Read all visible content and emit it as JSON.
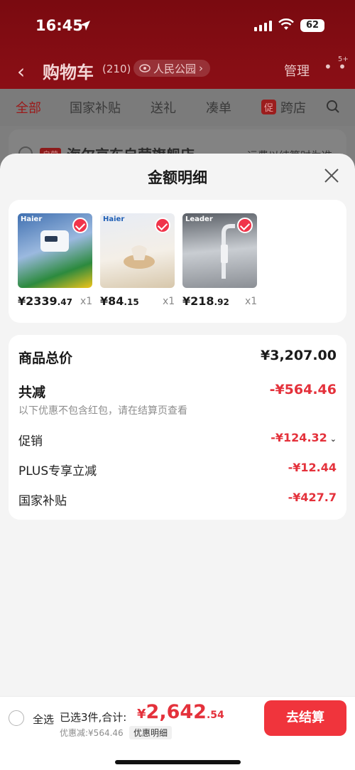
{
  "status_bar": {
    "time": "16:45",
    "battery": "62"
  },
  "header": {
    "title": "购物车",
    "count": "(210)",
    "location": "人民公园",
    "manage": "管理",
    "more_badge": "5+"
  },
  "tabs": [
    {
      "label": "全部"
    },
    {
      "label": "国家补贴"
    },
    {
      "label": "送礼"
    },
    {
      "label": "凑单"
    },
    {
      "label": "跨店",
      "tag": "促"
    }
  ],
  "shop": {
    "tag": "自营",
    "name": "海尔京东自营旗舰店",
    "note": "运费以结算时为准"
  },
  "sheet": {
    "title": "金额明细",
    "products": [
      {
        "brand": "Haier",
        "price_int": "¥2339",
        "price_dec": ".47",
        "qty": "x1"
      },
      {
        "brand": "Haier",
        "price_int": "¥84",
        "price_dec": ".15",
        "qty": "x1"
      },
      {
        "brand": "Leader",
        "price_int": "¥218",
        "price_dec": ".92",
        "qty": "x1"
      }
    ],
    "summary": {
      "total_label": "商品总价",
      "total_value": "¥3,207.00",
      "off_label": "共减",
      "off_value": "-¥564.46",
      "off_note": "以下优惠不包含红包，请在结算页查看",
      "promo_label": "促销",
      "promo_value": "-¥124.32",
      "plus_label": "PLUS专享立减",
      "plus_value": "-¥12.44",
      "subsidy_label": "国家补贴",
      "subsidy_value": "-¥427.7"
    }
  },
  "bottom": {
    "select_all": "全选",
    "selected_text": "已选3件,合计:",
    "total_yen": "¥",
    "total_int": "2,642",
    "total_dec": ".54",
    "discount_line": "优惠减:¥564.46",
    "detail_chip": "优惠明细",
    "checkout": "去结算"
  },
  "colors": {
    "accent": "#e4313b",
    "header_bg": "#7a0a10",
    "checkout_bg": "#f0343c"
  }
}
